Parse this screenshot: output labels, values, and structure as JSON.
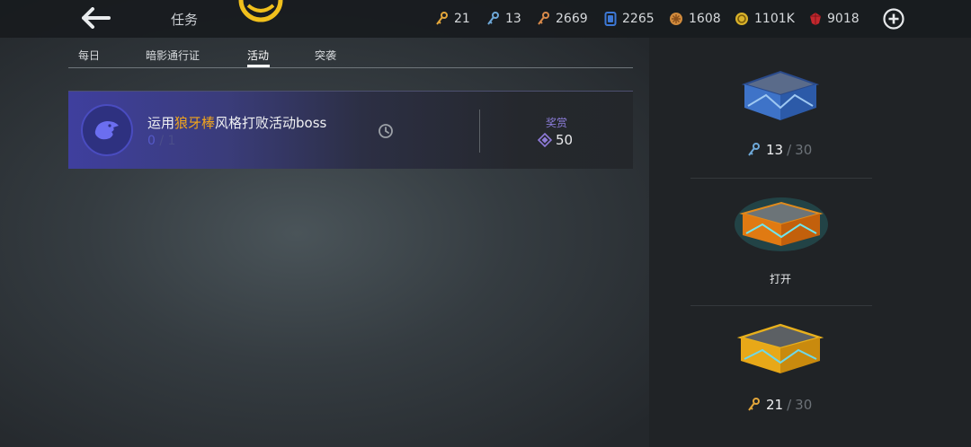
{
  "header": {
    "title": "任务",
    "resources": [
      {
        "icon": "gold-key-icon",
        "value": "21",
        "color": "#e3a63a"
      },
      {
        "icon": "blue-key-icon",
        "value": "13",
        "color": "#6ea8d8"
      },
      {
        "icon": "orange-key-icon",
        "value": "2669",
        "color": "#d98a4a"
      },
      {
        "icon": "card-icon",
        "value": "2265",
        "color": "#3d78d6"
      },
      {
        "icon": "orb-icon",
        "value": "1608",
        "color": "#d08a3c"
      },
      {
        "icon": "coin-icon",
        "value": "1101K",
        "color": "#d8b22a"
      },
      {
        "icon": "gem-icon",
        "value": "9018",
        "color": "#c3282e"
      }
    ]
  },
  "tabs": [
    {
      "label": "每日",
      "active": false
    },
    {
      "label": "暗影通行证",
      "active": false
    },
    {
      "label": "活动",
      "active": true
    },
    {
      "label": "突袭",
      "active": false
    }
  ],
  "task": {
    "text_prefix": "运用",
    "text_highlight": "狼牙棒",
    "text_suffix": "风格打败活动boss",
    "progress_current": "0",
    "progress_separator": "/",
    "progress_total": "1",
    "reward_label": "奖赏",
    "reward_value": "50"
  },
  "chests": [
    {
      "name": "blue-chest",
      "count": "13",
      "separator": "/",
      "max": "30",
      "key_color": "#6ea8d8"
    },
    {
      "name": "orange-chest",
      "action_label": "打开"
    },
    {
      "name": "gold-chest",
      "count": "21",
      "separator": "/",
      "max": "30",
      "key_color": "#e3a63a"
    }
  ]
}
